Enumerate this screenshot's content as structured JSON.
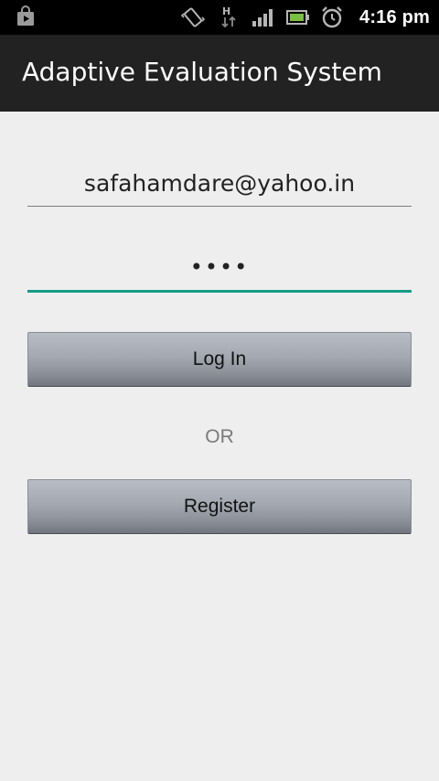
{
  "status_bar": {
    "time": "4:16 pm",
    "icons": [
      "shopping-bag-icon",
      "vibrate-icon",
      "network-h-icon",
      "signal-icon",
      "battery-icon",
      "alarm-icon"
    ]
  },
  "app": {
    "title": "Adaptive Evaluation System"
  },
  "login_form": {
    "email_value": "safahamdare@yahoo.in",
    "password_masked": "••••",
    "login_label": "Log In",
    "or_label": "OR",
    "register_label": "Register"
  },
  "colors": {
    "status_bar_bg": "#000000",
    "action_bar_bg": "#222222",
    "page_bg": "#eeeeee",
    "focus_accent": "#169c86",
    "button_gradient_top": "#b8bdc5",
    "button_gradient_bottom": "#72767e"
  }
}
